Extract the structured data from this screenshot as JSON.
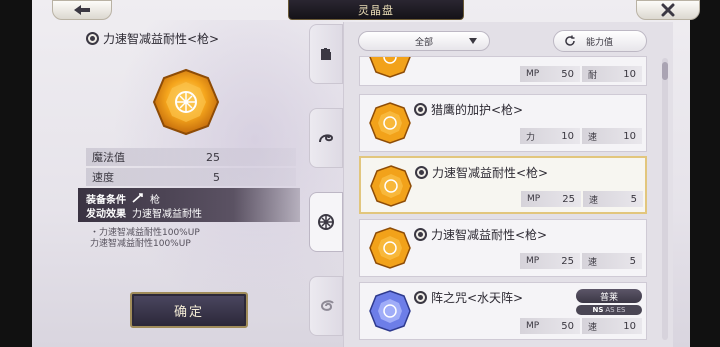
{
  "window": {
    "title": "灵晶盘"
  },
  "detail": {
    "title": "力速智减益耐性<枪>",
    "stats": [
      {
        "label": "魔法值",
        "value": "25"
      },
      {
        "label": "速度",
        "value": "5"
      }
    ],
    "equip_condition_label": "装备条件",
    "equip_condition_value": "枪",
    "activate_effect_label": "发动效果",
    "activate_effect_value": "力速智减益耐性",
    "effect_notes": [
      "・力速智减益耐性100%UP",
      "力速智减益耐性100%UP"
    ],
    "confirm_label": "确定"
  },
  "filter": {
    "selected": "全部"
  },
  "sort": {
    "label": "能力值"
  },
  "list": [
    {
      "name": "",
      "stats": [
        {
          "k": "MP",
          "v": "50"
        },
        {
          "k": "耐",
          "v": "10"
        }
      ],
      "gem": "amber"
    },
    {
      "name": "猎鹰的加护<枪>",
      "stats": [
        {
          "k": "力",
          "v": "10"
        },
        {
          "k": "速",
          "v": "10"
        }
      ],
      "gem": "amber"
    },
    {
      "name": "力速智减益耐性<枪>",
      "stats": [
        {
          "k": "MP",
          "v": "25"
        },
        {
          "k": "速",
          "v": "5"
        }
      ],
      "gem": "amber",
      "selected": true
    },
    {
      "name": "力速智减益耐性<枪>",
      "stats": [
        {
          "k": "MP",
          "v": "25"
        },
        {
          "k": "速",
          "v": "5"
        }
      ],
      "gem": "amber"
    },
    {
      "name": "阵之咒<水天阵>",
      "stats": [
        {
          "k": "MP",
          "v": "50"
        },
        {
          "k": "速",
          "v": "10"
        }
      ],
      "gem": "blue",
      "rarity": "普莱",
      "types": [
        "NS",
        "AS",
        "ES"
      ]
    }
  ],
  "colors": {
    "accent_gold": "#e2c67d",
    "gem_amber": "#f2a21a",
    "gem_blue": "#6d7ee8",
    "title_bar": "#1b1820"
  }
}
